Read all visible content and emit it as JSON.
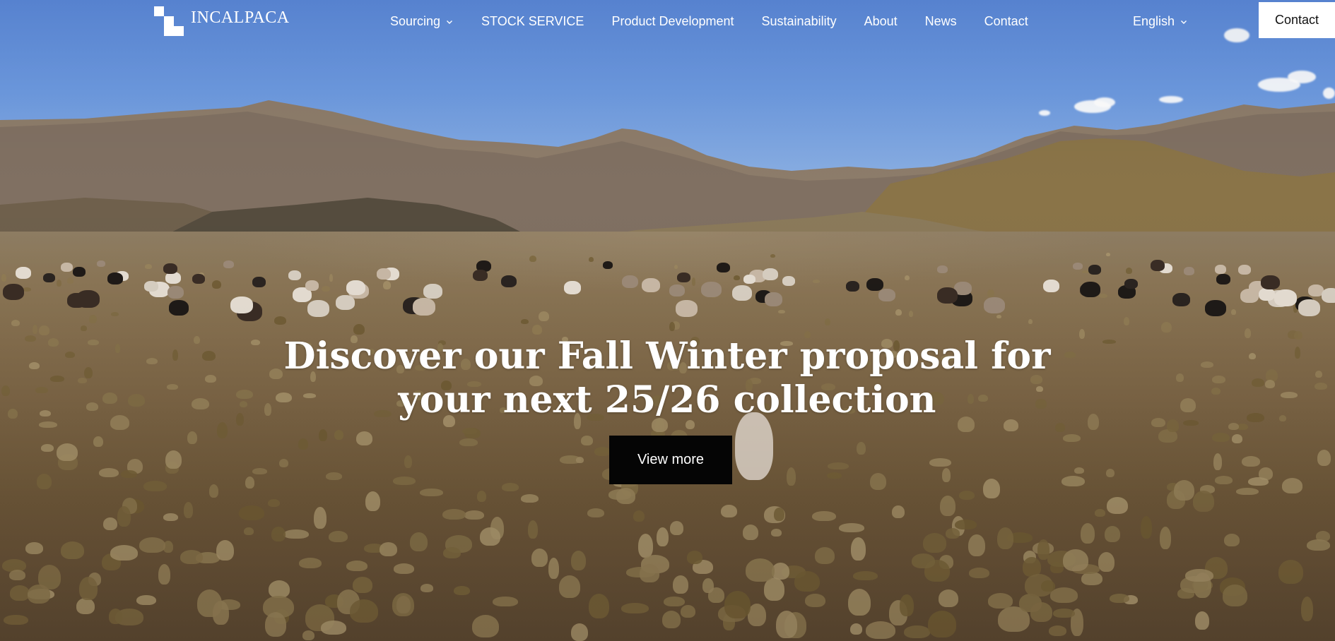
{
  "brand": {
    "name": "INCALPACA"
  },
  "nav": {
    "items": [
      {
        "label": "Sourcing",
        "has_dropdown": true
      },
      {
        "label": "STOCK SERVICE",
        "has_dropdown": false
      },
      {
        "label": "Product Development",
        "has_dropdown": false
      },
      {
        "label": "Sustainability",
        "has_dropdown": false
      },
      {
        "label": "About",
        "has_dropdown": false
      },
      {
        "label": "News",
        "has_dropdown": false
      },
      {
        "label": "Contact",
        "has_dropdown": false
      }
    ],
    "language": "English",
    "contact_button": "Contact"
  },
  "hero": {
    "headline_line1": "Discover our Fall Winter proposal for",
    "headline_line2": "your next 25/26 collection",
    "cta_label": "View more",
    "background": "hero-landscape-alpacas-image"
  },
  "colors": {
    "sky": "#5b89da",
    "button_dark": "#050505",
    "button_light": "#ffffff",
    "text_light": "#ffffff"
  }
}
